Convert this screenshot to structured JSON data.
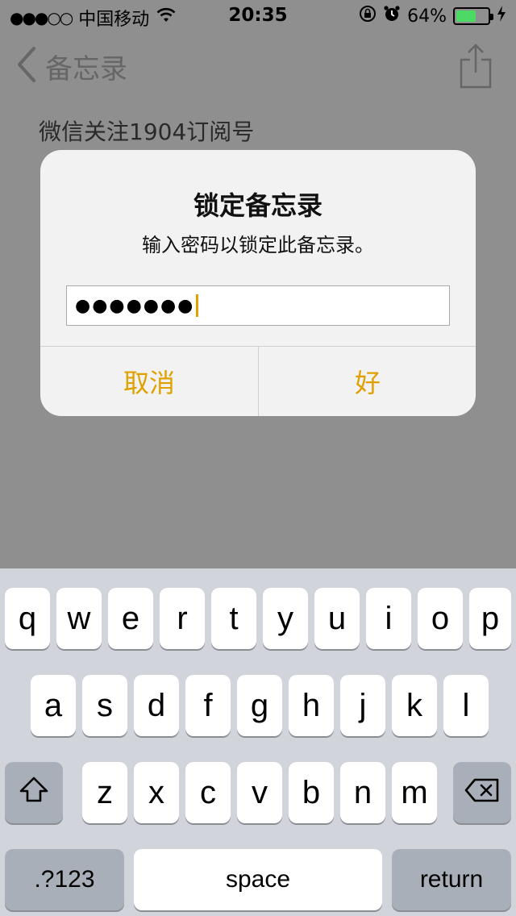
{
  "status_bar": {
    "signal": "●●●○○",
    "carrier": "中国移动",
    "time": "20:35",
    "battery_percent": "64%",
    "battery_level": 0.64,
    "icons": [
      "wifi-icon",
      "orientation-lock-icon",
      "alarm-icon",
      "battery-icon",
      "charging-icon"
    ]
  },
  "nav": {
    "back_label": "备忘录"
  },
  "note": {
    "first_line": "微信关注1904订阅号"
  },
  "alert": {
    "title": "锁定备忘录",
    "message": "输入密码以锁定此备忘录。",
    "password_masked": "●●●●●●●",
    "cancel_label": "取消",
    "ok_label": "好"
  },
  "keyboard": {
    "row1": [
      "q",
      "w",
      "e",
      "r",
      "t",
      "y",
      "u",
      "i",
      "o",
      "p"
    ],
    "row2": [
      "a",
      "s",
      "d",
      "f",
      "g",
      "h",
      "j",
      "k",
      "l"
    ],
    "row3": [
      "z",
      "x",
      "c",
      "v",
      "b",
      "n",
      "m"
    ],
    "numbers_label": ".?123",
    "space_label": "space",
    "return_label": "return"
  },
  "colors": {
    "accent": "#e0a000",
    "battery_fill": "#4cd964",
    "keyboard_bg": "#d1d5db"
  }
}
